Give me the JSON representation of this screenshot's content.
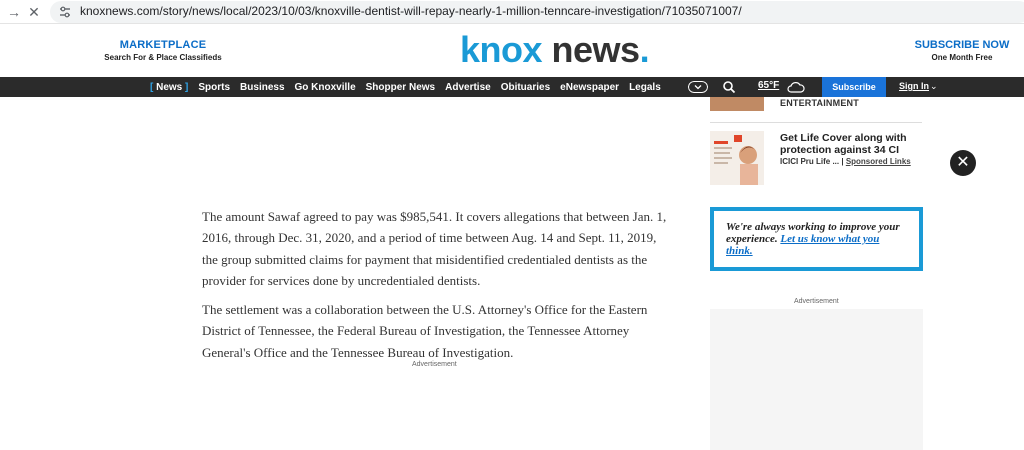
{
  "browser": {
    "url": "knoxnews.com/story/news/local/2023/10/03/knoxville-dentist-will-repay-nearly-1-million-tenncare-investigation/71035071007/"
  },
  "header": {
    "marketplace_title": "MARKETPLACE",
    "marketplace_sub": "Search For & Place Classifieds",
    "logo_knox": "knox",
    "logo_news": "news",
    "logo_dot": ".",
    "subscribe_title": "SUBSCRIBE NOW",
    "subscribe_sub": "One Month Free"
  },
  "nav": {
    "items": [
      "News",
      "Sports",
      "Business",
      "Go Knoxville",
      "Shopper News",
      "Advertise",
      "Obituaries",
      "eNewspaper",
      "Legals"
    ],
    "bracket_open": "[",
    "bracket_close": "]",
    "weather": "65°F",
    "subscribe": "Subscribe",
    "sign_in": "Sign In"
  },
  "article": {
    "paragraphs": [
      "The amount Sawaf agreed to pay was $985,541. It covers allegations that between Jan. 1, 2016, through Dec. 31, 2020, and a period of time between Aug. 14 and Sept. 11, 2019, the group submitted claims for payment that misidentified credentialed dentists as the provider for services done by uncredentialed dentists.",
      "The settlement was a collaboration between the U.S. Attorney's Office for the Eastern District of Tennessee, the Federal Bureau of Investigation, the Tennessee Attorney General's Office and the Tennessee Bureau of Investigation."
    ],
    "ad_label": "Advertisement"
  },
  "rail": {
    "category": "ENTERTAINMENT",
    "promo_title": "Get Life Cover along with protection against 34 CI",
    "promo_source": "ICICI Pru Life ...",
    "promo_sep": " | ",
    "promo_sponsored": "Sponsored Links",
    "feedback_text": "We're always working to improve your experience.",
    "feedback_link": "Let us know what you think.",
    "ad_label": "Advertisement"
  },
  "colors": {
    "brand_blue": "#1a9ad6",
    "link_blue": "#0b6dc7",
    "nav_bg": "#2b2b2b",
    "subscribe_bg": "#1a73d9"
  }
}
